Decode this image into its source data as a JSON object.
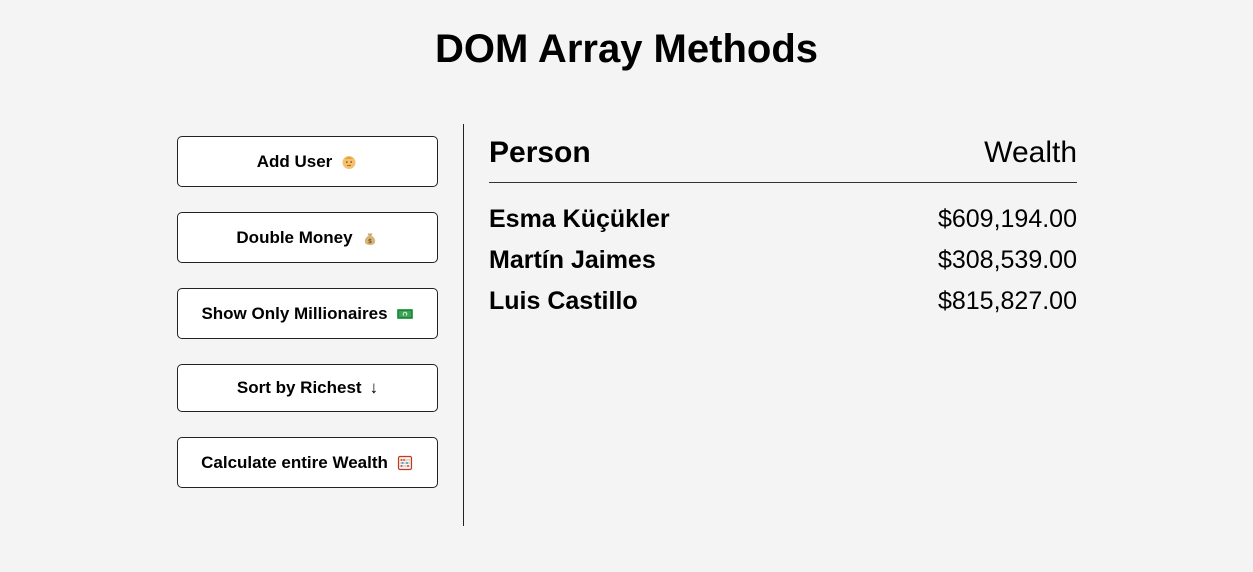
{
  "title": "DOM Array Methods",
  "buttons": [
    {
      "label": "Add User",
      "icon": "baby-face-icon"
    },
    {
      "label": "Double Money",
      "icon": "money-bag-icon"
    },
    {
      "label": "Show Only Millionaires",
      "icon": "dollar-banknote-icon"
    },
    {
      "label": "Sort by Richest",
      "icon": "down-arrow-icon",
      "glyph": "↓"
    },
    {
      "label": "Calculate entire Wealth",
      "icon": "abacus-icon"
    }
  ],
  "table": {
    "header_person": "Person",
    "header_wealth": "Wealth",
    "rows": [
      {
        "name": "Esma Küçükler",
        "wealth": "$609,194.00"
      },
      {
        "name": "Martín Jaimes",
        "wealth": "$308,539.00"
      },
      {
        "name": "Luis Castillo",
        "wealth": "$815,827.00"
      }
    ]
  },
  "colors": {
    "background": "#f4f4f4",
    "button_background": "#ffffff",
    "border": "#222222"
  }
}
